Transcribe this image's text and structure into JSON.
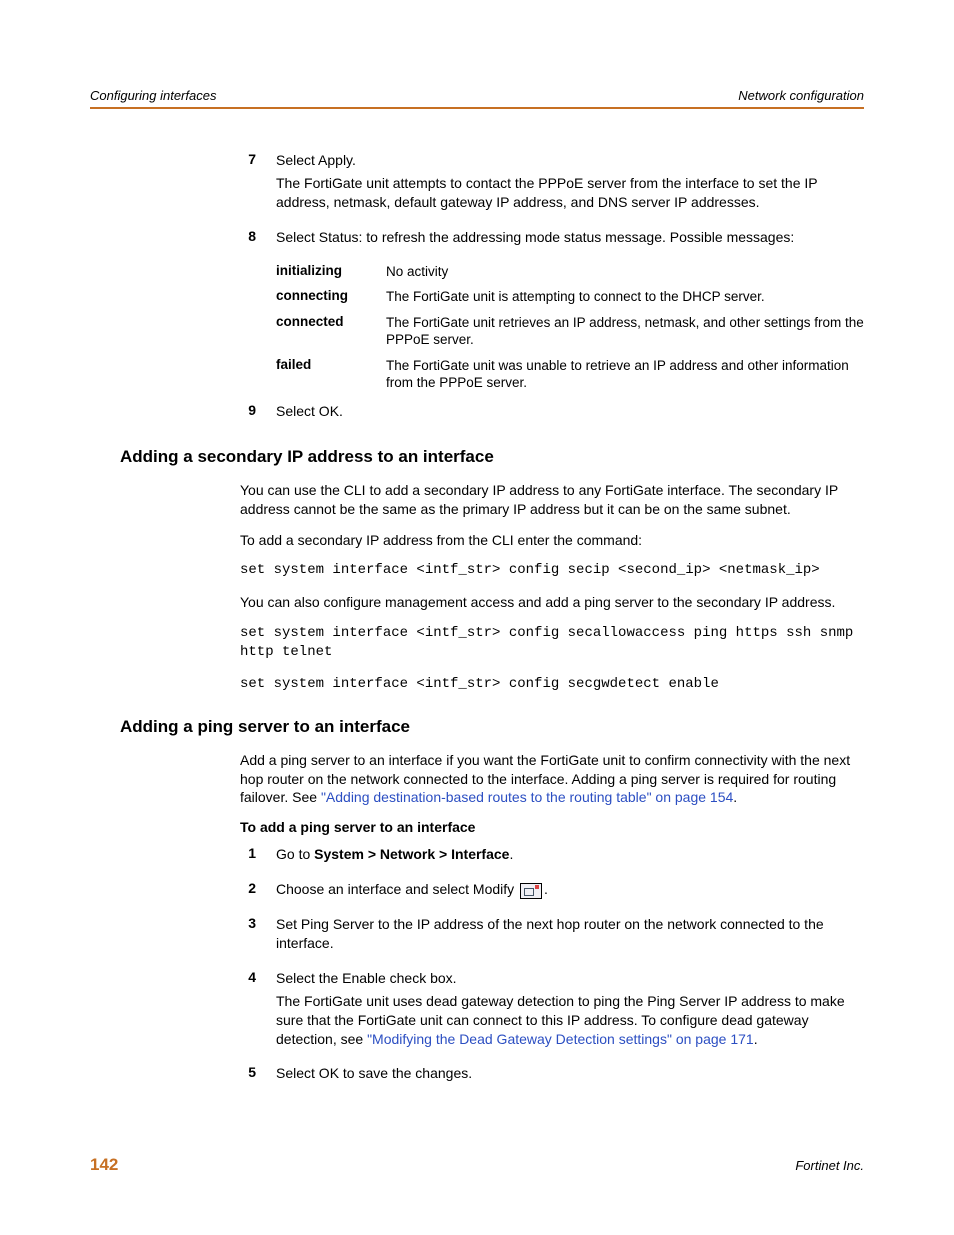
{
  "header": {
    "left": "Configuring interfaces",
    "right": "Network configuration"
  },
  "steps_a": {
    "s7": {
      "num": "7",
      "a": "Select Apply.",
      "b": "The FortiGate unit attempts to contact the PPPoE server from the interface to set the IP address, netmask, default gateway IP address, and DNS server IP addresses."
    },
    "s8": {
      "num": "8",
      "a": "Select Status: to refresh the addressing mode status message. Possible messages:"
    },
    "s9": {
      "num": "9",
      "a": "Select OK."
    }
  },
  "status": {
    "r1": {
      "label": "initializing",
      "desc": "No activity"
    },
    "r2": {
      "label": "connecting",
      "desc": "The FortiGate unit is attempting to connect to the DHCP server."
    },
    "r3": {
      "label": "connected",
      "desc": "The FortiGate unit retrieves an IP address, netmask, and other settings from the PPPoE server."
    },
    "r4": {
      "label": "failed",
      "desc": "The FortiGate unit was unable to retrieve an IP address and other information from the PPPoE server."
    }
  },
  "sec1": {
    "heading": "Adding a secondary IP address to an interface",
    "p1": "You can use the CLI to add a secondary IP address to any FortiGate interface. The secondary IP address cannot be the same as the primary IP address but it can be on the same subnet.",
    "p2": "To add a secondary IP address from the CLI enter the command:",
    "code1": "set system interface <intf_str> config secip <second_ip> <netmask_ip>",
    "p3": "You can also configure management access and add a ping server to the secondary IP address.",
    "code2": "set system interface <intf_str> config secallowaccess ping https ssh snmp http telnet",
    "code3": "set system interface <intf_str> config secgwdetect enable"
  },
  "sec2": {
    "heading": "Adding a ping server to an interface",
    "p1a": "Add a ping server to an interface if you want the FortiGate unit to confirm connectivity with the next hop router on the network connected to the interface. Adding a ping server is required for routing failover. See ",
    "p1link": "\"Adding destination-based routes to the routing table\" on page 154",
    "p1b": ".",
    "sub": "To add a ping server to an interface",
    "s1": {
      "num": "1",
      "pre": "Go to ",
      "bold": "System > Network > Interface",
      "post": "."
    },
    "s2": {
      "num": "2",
      "a": "Choose an interface and select Modify ",
      "b": "."
    },
    "s3": {
      "num": "3",
      "a": "Set Ping Server to the IP address of the next hop router on the network connected to the interface."
    },
    "s4": {
      "num": "4",
      "a": "Select the Enable check box.",
      "b": "The FortiGate unit uses dead gateway detection to ping the Ping Server IP address to make sure that the FortiGate unit can connect to this IP address. To configure dead gateway detection, see ",
      "link": "\"Modifying the Dead Gateway Detection settings\" on page 171",
      "c": "."
    },
    "s5": {
      "num": "5",
      "a": "Select OK to save the changes."
    }
  },
  "footer": {
    "page": "142",
    "right": "Fortinet Inc."
  }
}
